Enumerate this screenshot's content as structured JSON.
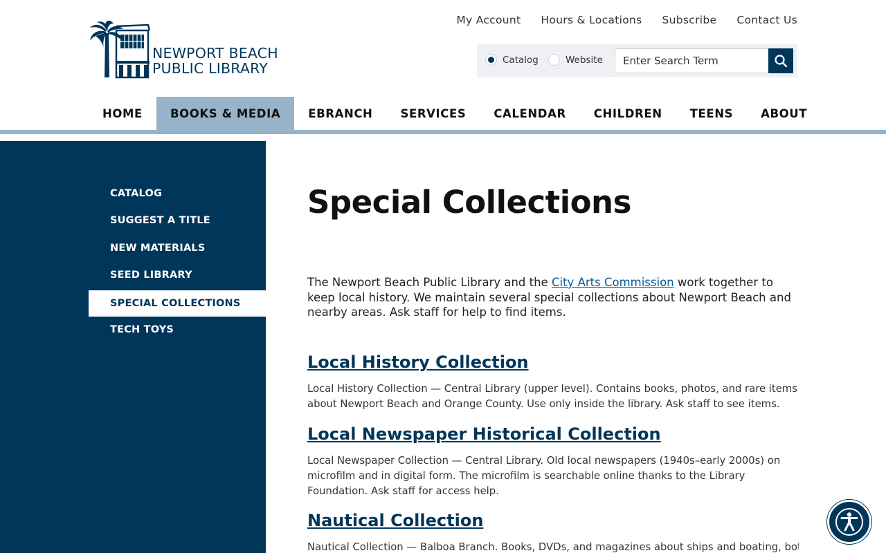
{
  "logo": {
    "line1": "NEWPORT BEACH",
    "line2": "PUBLIC LIBRARY"
  },
  "utility_nav": [
    "My Account",
    "Hours & Locations",
    "Subscribe",
    "Contact Us"
  ],
  "search": {
    "scope_options": [
      "Catalog",
      "Website"
    ],
    "selected_scope": "Catalog",
    "placeholder": "Enter Search Term",
    "value": ""
  },
  "main_nav": {
    "items": [
      "HOME",
      "BOOKS & MEDIA",
      "EBRANCH",
      "SERVICES",
      "CALENDAR",
      "CHILDREN",
      "TEENS",
      "ABOUT"
    ],
    "active": "BOOKS & MEDIA"
  },
  "sidebar": {
    "items": [
      "CATALOG",
      "SUGGEST A TITLE",
      "NEW MATERIALS",
      "SEED LIBRARY",
      "SPECIAL COLLECTIONS",
      "TECH TOYS"
    ],
    "active": "SPECIAL COLLECTIONS"
  },
  "page": {
    "title": "Special Collections",
    "intro_before": "The Newport Beach Public Library and the ",
    "intro_link": "City Arts Commission",
    "intro_after": " work together to keep local history. We maintain several special collections about Newport Beach and nearby areas. Ask staff for help to find items.",
    "sections": [
      {
        "title": "Local History Collection",
        "body": "Local History Collection — Central Library (upper level). Contains books, photos, and rare items about Newport Beach and Orange County. Use only inside the library. Ask staff to see items."
      },
      {
        "title": "Local Newspaper Historical Collection",
        "body": "Local Newspaper Collection — Central Library. Old local newspapers (1940s–early 2000s) on microfilm and in digital form. The microfilm is searchable online thanks to the Library Foundation. Ask staff for access help."
      },
      {
        "title": "Nautical Collection",
        "body": "Nautical Collection — Balboa Branch. Books, DVDs, and magazines about ships and boating, both"
      }
    ]
  },
  "colors": {
    "navy": "#00365a",
    "nav_active": "#96b3c9",
    "link": "#005a9c"
  },
  "icons": {
    "search": "search-icon",
    "accessibility": "accessibility-icon"
  }
}
